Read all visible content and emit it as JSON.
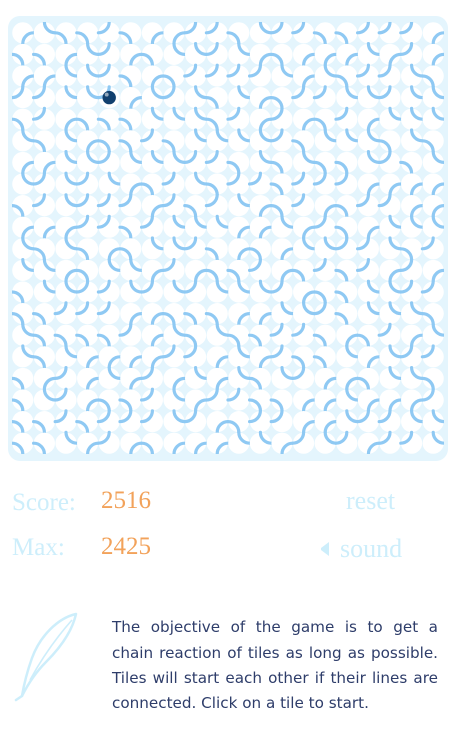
{
  "game": {
    "grid_size": 20,
    "active_tile": {
      "row": 3,
      "col": 4
    },
    "colors": {
      "board_bg": "#e4f5fd",
      "tile_bg": "#ffffff",
      "arc": "#8fc9f3",
      "arc_highlight": "#a9d7f6",
      "ball": "#12406e",
      "label": "#cdeefb",
      "value": "#f2a25a",
      "text": "#2e3d6a"
    }
  },
  "stats": {
    "score_label": "Score:",
    "score_value": "2516",
    "max_label": "Max:",
    "max_value": "2425"
  },
  "controls": {
    "reset_label": "reset",
    "sound_label": "sound",
    "sound_icon": "speaker-icon"
  },
  "info": {
    "icon": "quill-icon",
    "description": "The objective of the game is to get a chain reaction of tiles as long as possible. Tiles will start each other if their lines are connected. Click on a tile to start."
  }
}
